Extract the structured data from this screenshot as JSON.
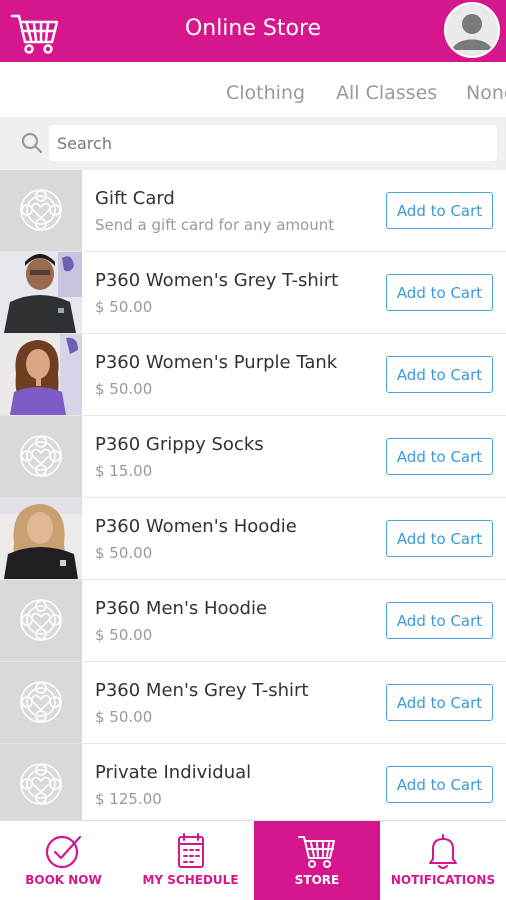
{
  "header": {
    "title": "Online Store",
    "cart_icon": "shopping-cart-icon",
    "avatar_icon": "user-avatar-icon"
  },
  "tabs": [
    {
      "label": "Clothing"
    },
    {
      "label": "All Classes"
    },
    {
      "label": "None"
    }
  ],
  "search": {
    "placeholder": "Search",
    "value": ""
  },
  "products": [
    {
      "name": "Gift Card",
      "detail": "Send a gift card for any amount",
      "thumb": "placeholder",
      "button": "Add to Cart"
    },
    {
      "name": "P360 Women's Grey T-shirt",
      "detail": "$ 50.00",
      "thumb": "photo-grey-tshirt",
      "button": "Add to Cart"
    },
    {
      "name": "P360 Women's Purple Tank",
      "detail": "$ 50.00",
      "thumb": "photo-purple-tank",
      "button": "Add to Cart"
    },
    {
      "name": "P360 Grippy Socks",
      "detail": "$ 15.00",
      "thumb": "placeholder",
      "button": "Add to Cart"
    },
    {
      "name": "P360 Women's Hoodie",
      "detail": "$ 50.00",
      "thumb": "photo-womens-hoodie",
      "button": "Add to Cart"
    },
    {
      "name": "P360 Men's Hoodie",
      "detail": "$ 50.00",
      "thumb": "placeholder",
      "button": "Add to Cart"
    },
    {
      "name": "P360 Men's Grey T-shirt",
      "detail": "$ 50.00",
      "thumb": "placeholder",
      "button": "Add to Cart"
    },
    {
      "name": "Private Individual",
      "detail": "$ 125.00",
      "thumb": "placeholder",
      "button": "Add to Cart"
    }
  ],
  "nav": [
    {
      "label": "BOOK NOW",
      "icon": "check-circle-icon",
      "active": false
    },
    {
      "label": "MY SCHEDULE",
      "icon": "calendar-icon",
      "active": false
    },
    {
      "label": "STORE",
      "icon": "shopping-cart-icon",
      "active": true
    },
    {
      "label": "NOTIFICATIONS",
      "icon": "bell-icon",
      "active": false
    }
  ],
  "colors": {
    "brand": "#d6168c",
    "button_border": "#4aa3df",
    "placeholder_bg": "#d9d9d9"
  }
}
